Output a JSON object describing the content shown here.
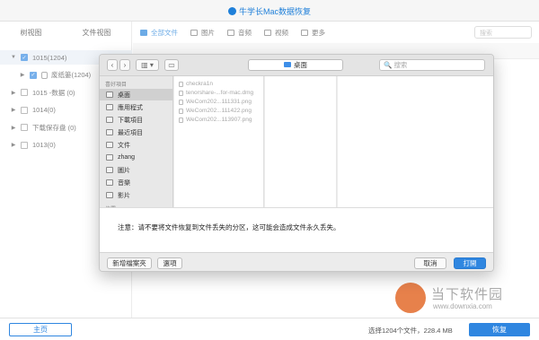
{
  "app": {
    "title": "牛学长Mac数据恢复"
  },
  "sidebar": {
    "tabs": [
      "树视图",
      "文件视图"
    ],
    "tree": [
      {
        "label": "1015(1204)",
        "arrow": "▼",
        "checked": true,
        "icon": false
      },
      {
        "label": "废纸篓(1204)",
        "arrow": "▶",
        "checked": true,
        "icon": true
      },
      {
        "label": "1015 -数据 (0)",
        "arrow": "▶",
        "checked": false,
        "icon": false
      },
      {
        "label": "1014(0)",
        "arrow": "▶",
        "checked": false,
        "icon": false
      },
      {
        "label": "下载保存盘 (0)",
        "arrow": "▶",
        "checked": false,
        "icon": false
      },
      {
        "label": "1013(0)",
        "arrow": "▶",
        "checked": false,
        "icon": false
      }
    ]
  },
  "toolbar": {
    "items": [
      {
        "label": "全部文件",
        "icon": "folder-icon",
        "active": true
      },
      {
        "label": "图片",
        "icon": "image-icon",
        "active": false
      },
      {
        "label": "音频",
        "icon": "audio-icon",
        "active": false
      },
      {
        "label": "视频",
        "icon": "video-icon",
        "active": false
      },
      {
        "label": "更多",
        "icon": "more-icon",
        "active": false
      }
    ],
    "search_placeholder": "搜索"
  },
  "dialog": {
    "location": "桌面",
    "search_placeholder": "搜索",
    "favorites_header": "喜好項目",
    "locations_header": "位置",
    "favorites": [
      {
        "label": "桌面",
        "selected": true
      },
      {
        "label": "應用程式",
        "selected": false
      },
      {
        "label": "下載項目",
        "selected": false
      },
      {
        "label": "最近項目",
        "selected": false
      },
      {
        "label": "文件",
        "selected": false
      },
      {
        "label": "zhang",
        "selected": false
      },
      {
        "label": "圖片",
        "selected": false
      },
      {
        "label": "音樂",
        "selected": false
      },
      {
        "label": "影片",
        "selected": false
      }
    ],
    "files": [
      "checkra1n",
      "tenorshare-...for-mac.dmg",
      "WeCom202...111331.png",
      "WeCom202...111422.png",
      "WeCom202...113907.png"
    ],
    "notice": "注意：请不要将文件恢复到文件丢失的分区，这可能会造成文件永久丢失。",
    "buttons": {
      "new_folder": "新增檔案夾",
      "options": "選項",
      "cancel": "取消",
      "open": "打開"
    }
  },
  "status": {
    "home": "主页",
    "summary": "选择1204个文件，228.4 MB",
    "recover": "恢复"
  },
  "watermark": {
    "title": "当下软件园",
    "url": "www.downxia.com"
  },
  "colors": {
    "accent": "#2f86e0",
    "title_blue": "#1e7fd9"
  }
}
